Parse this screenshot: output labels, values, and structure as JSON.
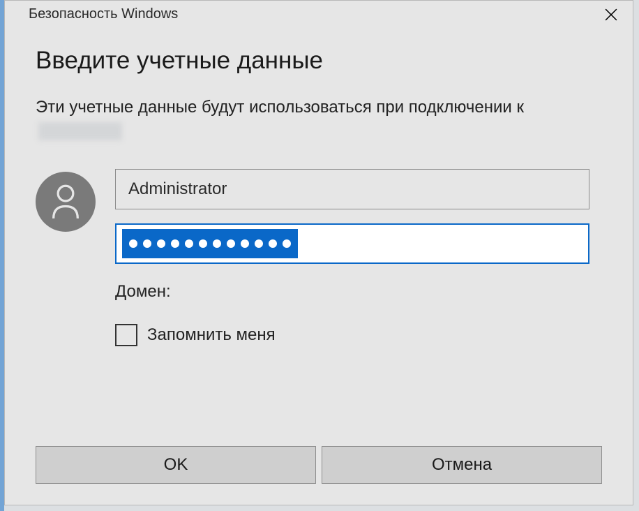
{
  "titlebar": {
    "title": "Безопасность Windows"
  },
  "dialog": {
    "heading": "Введите учетные данные",
    "subtext_prefix": "Эти учетные данные будут использоваться при подключении к",
    "username": "Administrator",
    "password_masked_length": 12,
    "domain_label": "Домен:",
    "remember_label": "Запомнить меня",
    "remember_checked": false
  },
  "buttons": {
    "ok": "OK",
    "cancel": "Отмена"
  }
}
